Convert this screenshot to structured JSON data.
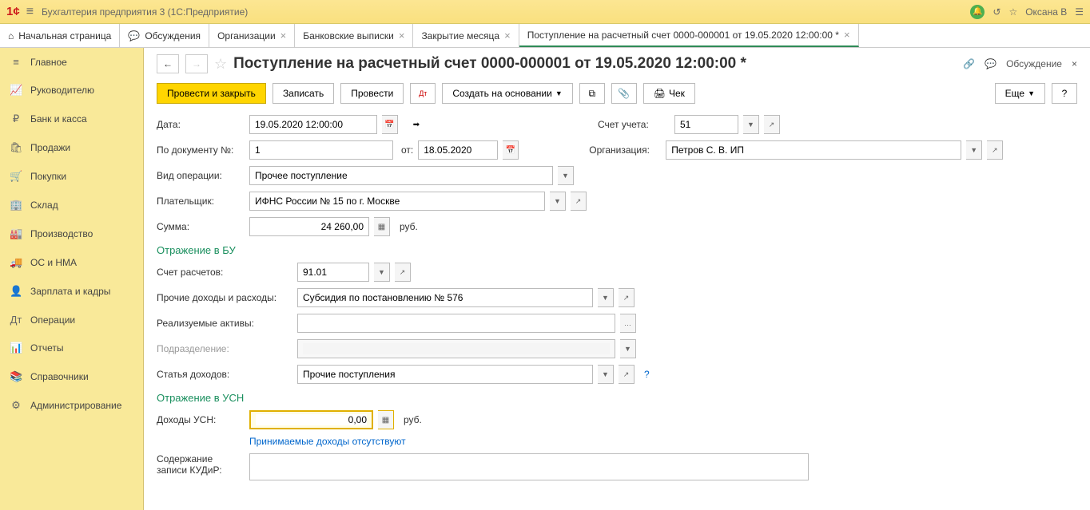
{
  "app": {
    "title": "Бухгалтерия предприятия 3  (1С:Предприятие)",
    "user": "Оксана В"
  },
  "tabs": {
    "home": "Начальная страница",
    "discuss": "Обсуждения",
    "items": [
      "Организации",
      "Банковские выписки",
      "Закрытие месяца"
    ],
    "active": "Поступление на расчетный счет 0000-000001 от 19.05.2020 12:00:00 *"
  },
  "sidebar": [
    {
      "icon": "≡",
      "label": "Главное"
    },
    {
      "icon": "📈",
      "label": "Руководителю"
    },
    {
      "icon": "₽",
      "label": "Банк и касса"
    },
    {
      "icon": "🛍",
      "label": "Продажи"
    },
    {
      "icon": "🛒",
      "label": "Покупки"
    },
    {
      "icon": "🏢",
      "label": "Склад"
    },
    {
      "icon": "🏭",
      "label": "Производство"
    },
    {
      "icon": "🚚",
      "label": "ОС и НМА"
    },
    {
      "icon": "👤",
      "label": "Зарплата и кадры"
    },
    {
      "icon": "Дт",
      "label": "Операции"
    },
    {
      "icon": "📊",
      "label": "Отчеты"
    },
    {
      "icon": "📚",
      "label": "Справочники"
    },
    {
      "icon": "⚙",
      "label": "Администрирование"
    }
  ],
  "doc": {
    "title": "Поступление на расчетный счет 0000-000001 от 19.05.2020 12:00:00 *",
    "discuss": "Обсуждение"
  },
  "toolbar": {
    "post_close": "Провести и закрыть",
    "write": "Записать",
    "post": "Провести",
    "create_from": "Создать на основании",
    "check": "Чек",
    "more": "Еще"
  },
  "form": {
    "date_label": "Дата:",
    "date": "19.05.2020 12:00:00",
    "account_label": "Счет учета:",
    "account": "51",
    "docnum_label": "По документу №:",
    "docnum": "1",
    "from_label": "от:",
    "from_date": "18.05.2020",
    "org_label": "Организация:",
    "org": "Петров С. В. ИП",
    "optype_label": "Вид операции:",
    "optype": "Прочее поступление",
    "payer_label": "Плательщик:",
    "payer": "ИФНС России № 15 по г. Москве",
    "sum_label": "Сумма:",
    "sum": "24 260,00",
    "rub": "руб.",
    "section_bu": "Отражение в БУ",
    "calc_acc_label": "Счет расчетов:",
    "calc_acc": "91.01",
    "other_label": "Прочие доходы и расходы:",
    "other": "Субсидия по постановлению № 576",
    "assets_label": "Реализуемые активы:",
    "division_label": "Подразделение:",
    "inc_item_label": "Статья доходов:",
    "inc_item": "Прочие поступления",
    "section_usn": "Отражение в УСН",
    "usn_label": "Доходы УСН:",
    "usn": "0,00",
    "usn_hint": "Принимаемые доходы отсутствуют",
    "kudir_label1": "Содержание",
    "kudir_label2": "записи КУДиР:"
  }
}
